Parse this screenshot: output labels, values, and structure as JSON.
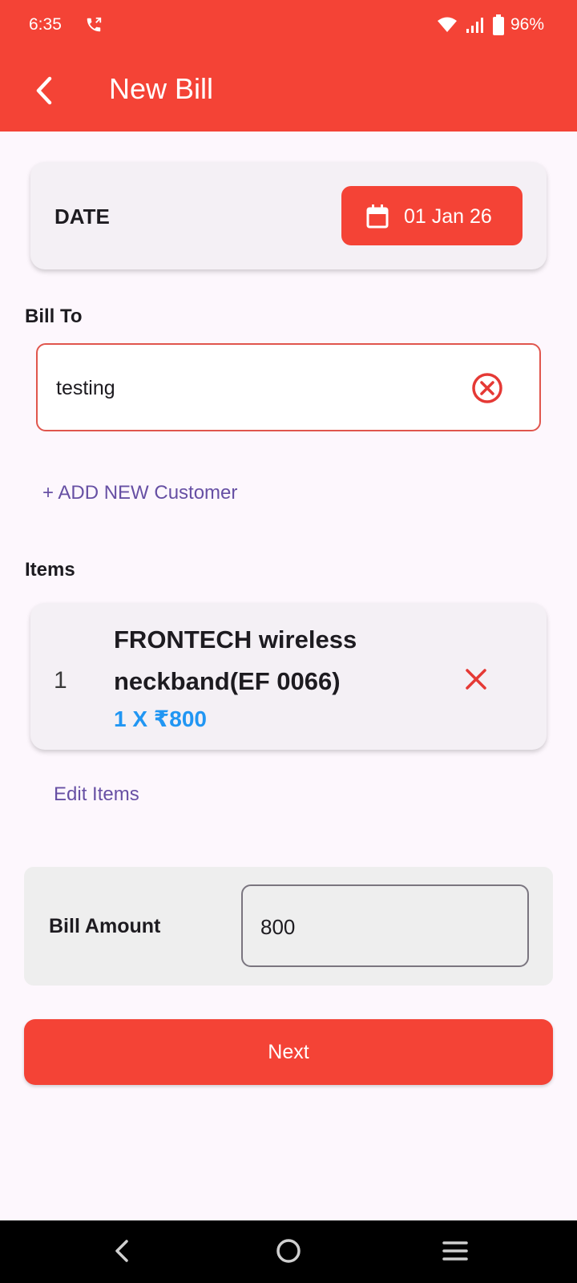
{
  "status_bar": {
    "time": "6:35",
    "battery": "96%",
    "icons": [
      "call-forward-icon",
      "wifi-icon",
      "signal-icon",
      "battery-icon"
    ]
  },
  "app_bar": {
    "title": "New Bill",
    "back_icon": "arrow-back-icon"
  },
  "date_section": {
    "label": "DATE",
    "value": "01 Jan 26",
    "icon": "calendar-icon"
  },
  "bill_to": {
    "label": "Bill To",
    "customer_value": "testing",
    "clear_icon": "clear-circle-icon",
    "add_customer_label": "+ ADD NEW Customer"
  },
  "items_section": {
    "label": "Items",
    "items": [
      {
        "index": "1",
        "name": "FRONTECH wireless neckband(EF 0066)",
        "price_line": "1 X ₹800"
      }
    ],
    "edit_label": "Edit Items"
  },
  "bill_amount": {
    "label": "Bill Amount",
    "value": "800"
  },
  "next_button": {
    "label": "Next"
  },
  "nav_bar": {
    "icons": [
      "nav-back-icon",
      "nav-home-icon",
      "nav-recents-icon"
    ]
  },
  "colors": {
    "primary": "#f44336",
    "background": "#fdf7fd",
    "card": "#f4f0f5",
    "link": "#6750a4",
    "price": "#2196f3"
  }
}
